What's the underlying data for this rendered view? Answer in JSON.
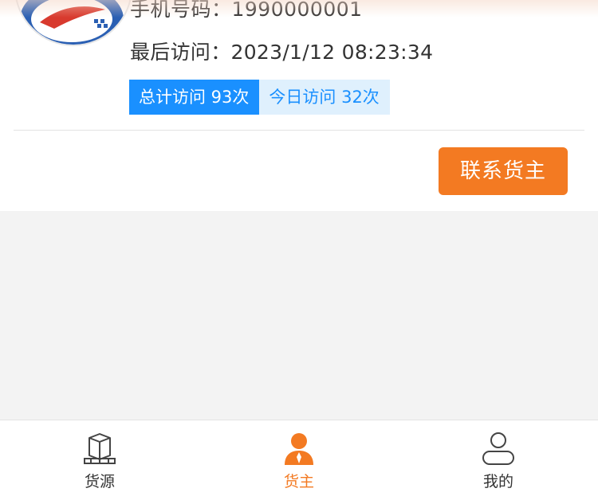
{
  "profile": {
    "phone_text": "手机号码：1990000001",
    "last_visit_text": "最后访问：2023/1/12 08:23:34",
    "total_visits_text": "总计访问 93次",
    "today_visits_text": "今日访问 32次"
  },
  "actions": {
    "contact_button_label": "联系货主"
  },
  "tabbar": {
    "items": [
      {
        "label": "货源",
        "icon": "cargo-box-icon",
        "active": false
      },
      {
        "label": "货主",
        "icon": "person-filled-icon",
        "active": true
      },
      {
        "label": "我的",
        "icon": "person-outline-icon",
        "active": false
      }
    ]
  },
  "colors": {
    "accent_orange": "#f37a22",
    "accent_blue": "#1a90ff",
    "light_blue_bg": "#dff0fd",
    "page_bg": "#f3f3f3"
  }
}
